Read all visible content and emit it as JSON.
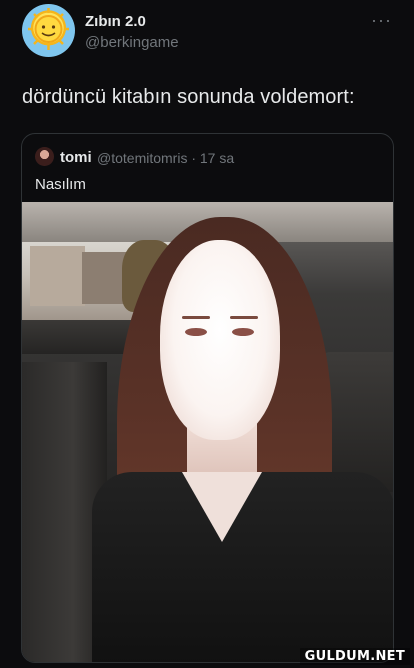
{
  "tweet": {
    "author_name": "Zıbın 2.0",
    "author_handle": "@berkingame",
    "text": "dördüncü kitabın sonunda voldemort:",
    "more_icon": "more-options-icon"
  },
  "quote": {
    "author_name": "tomi",
    "meta": "@totemitomris · 17 sa",
    "text": "Nasılım"
  },
  "watermark": "GULDUM.NET",
  "colors": {
    "background": "#0c0c0e",
    "primary_text": "#e7e9ea",
    "secondary_text": "#71767b",
    "border": "#2f3336"
  }
}
